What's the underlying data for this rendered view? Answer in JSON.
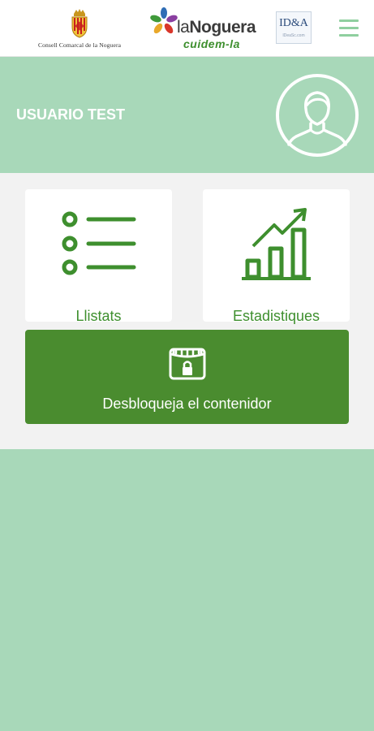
{
  "header": {
    "consell_logo_text": "Consell Comarcal de la Noguera",
    "noguera_logo": {
      "prefix": "la",
      "name": "Noguera",
      "tagline": "cuidem-la"
    },
    "idea_logo": {
      "mark": "ID&A",
      "sub": "IDeaSc.com"
    },
    "menu_icon": "hamburger-menu-icon"
  },
  "profile": {
    "username": "USUARIO TEST",
    "avatar_icon": "user-avatar-icon"
  },
  "tiles": {
    "lists": {
      "label": "Llistats",
      "icon": "list-icon"
    },
    "stats": {
      "label": "Estadistiques",
      "icon": "bar-chart-trend-icon"
    },
    "unlock": {
      "label": "Desbloqueja el contenidor",
      "icon": "locked-container-icon"
    }
  },
  "colors": {
    "accent_green": "#3e8f2e",
    "button_green": "#4a8c2f",
    "light_green": "#a8d8b9",
    "menu_green": "#8fcf9f",
    "tile_background": "#f2f2f2"
  }
}
